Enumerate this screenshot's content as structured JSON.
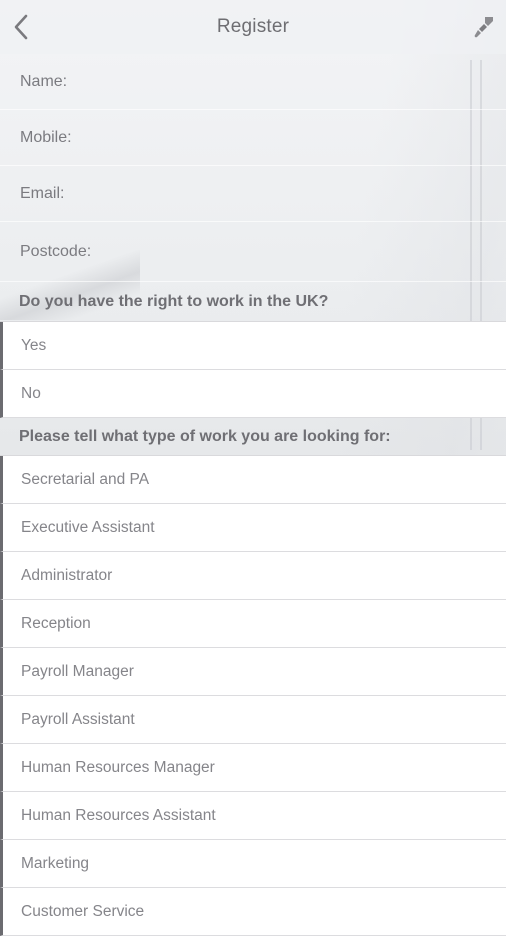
{
  "header": {
    "title": "Register",
    "back_icon": "chevron-left-icon",
    "tool_icon": "brush-icon"
  },
  "form": {
    "name_label": "Name:",
    "mobile_label": "Mobile:",
    "email_label": "Email:",
    "postcode_label": "Postcode:"
  },
  "right_to_work": {
    "question": "Do you have the right to work in the UK?",
    "options": [
      "Yes",
      "No"
    ]
  },
  "work_type": {
    "question": "Please tell what type of work you are looking for:",
    "options": [
      "Secretarial and PA",
      "Executive Assistant",
      "Administrator",
      "Reception",
      "Payroll Manager",
      "Payroll Assistant",
      "Human Resources Manager",
      "Human Resources Assistant",
      "Marketing",
      "Customer Service"
    ]
  },
  "colors": {
    "accent_bar": "#6b6b70",
    "text_gray": "#85858a",
    "header_text": "#6e6e72"
  }
}
